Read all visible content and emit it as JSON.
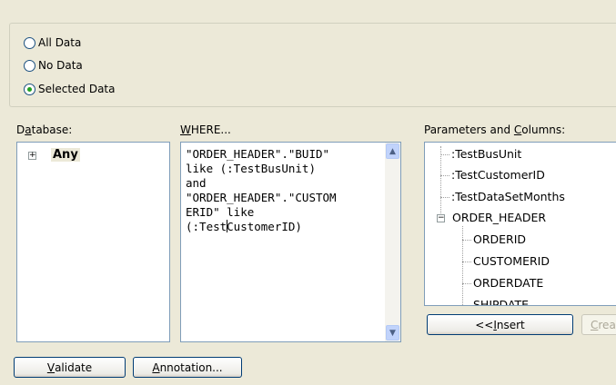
{
  "data_options": {
    "items": [
      {
        "label": "All Data",
        "checked": false
      },
      {
        "label": "No Data",
        "checked": false
      },
      {
        "label": "Selected Data",
        "checked": true
      }
    ]
  },
  "database": {
    "label_prefix": "D",
    "label_mnemonic": "a",
    "label_suffix": "tabase:",
    "item_label": "Any",
    "toggle_glyph": "⊞"
  },
  "where": {
    "label_mnemonic": "W",
    "label_suffix": "HERE...",
    "line1": "\"ORDER_HEADER\".\"BUID\"",
    "line2": "like (:TestBusUnit)",
    "line3": "and",
    "line4": "\"ORDER_HEADER\".\"CUSTOM",
    "line5": "ERID\" like",
    "line6_before_caret": "(:Test",
    "line6_after_caret": "CustomerID)"
  },
  "params": {
    "label_prefix": "Parameters and ",
    "label_mnemonic": "C",
    "label_suffix": "olumns:",
    "items": [
      ":TestBusUnit",
      ":TestCustomerID",
      ":TestDataSetMonths",
      "ORDER_HEADER",
      "ORDERID",
      "CUSTOMERID",
      "ORDERDATE",
      "SHIPDATE"
    ]
  },
  "buttons": {
    "insert_prefix": "<< ",
    "insert_mnemonic": "I",
    "insert_suffix": "nsert",
    "create_mnemonic": "C",
    "create_suffix": "rea",
    "validate_mnemonic": "V",
    "validate_suffix": "alidate",
    "annotation_mnemonic": "A",
    "annotation_suffix": "nnotation..."
  },
  "icons": {
    "scroll_up": "▲",
    "scroll_down": "▼",
    "tree_collapse": "−",
    "tree_expand": "+"
  }
}
